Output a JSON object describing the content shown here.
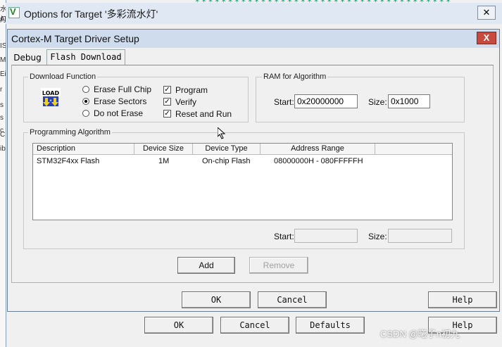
{
  "outer_window": {
    "title": "Options for Target '多彩流水灯'",
    "app_icon": "V",
    "close_icon": "close-icon",
    "buttons": {
      "ok": "OK",
      "cancel": "Cancel",
      "defaults": "Defaults",
      "help": "Help"
    }
  },
  "background_left_chars": [
    "水灯",
    "AI",
    "IS",
    "M",
    "Ei",
    "r",
    "s",
    "s",
    "c",
    "C",
    "ib"
  ],
  "dialog": {
    "title": "Cortex-M Target Driver Setup",
    "close_symbol": "X",
    "tabs": [
      {
        "label": "Debug",
        "active": false
      },
      {
        "label": "Flash Download",
        "active": true
      }
    ],
    "download_function": {
      "label": "Download Function",
      "icon_text": "LOAD",
      "erase_options": [
        {
          "label": "Erase Full Chip",
          "selected": false
        },
        {
          "label": "Erase Sectors",
          "selected": true
        },
        {
          "label": "Do not Erase",
          "selected": false
        }
      ],
      "checks": [
        {
          "label": "Program",
          "checked": true
        },
        {
          "label": "Verify",
          "checked": true
        },
        {
          "label": "Reset and Run",
          "checked": true
        }
      ]
    },
    "ram_for_algorithm": {
      "label": "RAM for Algorithm",
      "start_label": "Start:",
      "start_value": "0x20000000",
      "size_label": "Size:",
      "size_value": "0x1000"
    },
    "programming_algorithm": {
      "label": "Programming Algorithm",
      "columns": [
        "Description",
        "Device Size",
        "Device Type",
        "Address Range"
      ],
      "rows": [
        {
          "description": "STM32F4xx Flash",
          "device_size": "1M",
          "device_type": "On-chip Flash",
          "address_range": "08000000H - 080FFFFFH"
        }
      ],
      "start_label": "Start:",
      "size_label": "Size:",
      "start_value": "",
      "size_value": "",
      "add_label": "Add",
      "remove_label": "Remove"
    },
    "buttons": {
      "ok": "OK",
      "cancel": "Cancel",
      "help": "Help"
    }
  },
  "watermark": "CSDN @曦子n初九",
  "colors": {
    "accent_close": "#c84a3f",
    "title_bar": "#cfdced"
  }
}
